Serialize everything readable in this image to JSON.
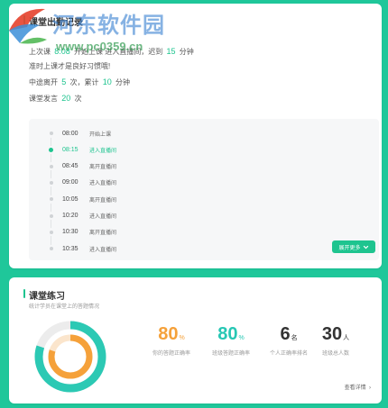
{
  "attendance": {
    "title": "课堂出勤记录",
    "line1": {
      "prefix": "上次课",
      "time": "8:08",
      "mid": "开始上课",
      "mid2": "进入直播间，迟到",
      "late": "15",
      "suffix": "分钟"
    },
    "line2": "准时上课才是良好习惯哦!",
    "line3": {
      "prefix": "中途离开",
      "leave_count": "5",
      "mid": "次，累计",
      "leave_minutes": "10",
      "suffix": "分钟"
    },
    "line4": {
      "prefix": "课堂发言",
      "speak_count": "20",
      "suffix": "次"
    },
    "timeline": [
      {
        "time": "08:00",
        "event": "开始上课",
        "active": false
      },
      {
        "time": "08:15",
        "event": "进入直播间",
        "active": true
      },
      {
        "time": "08:45",
        "event": "离开直播间",
        "active": false
      },
      {
        "time": "09:00",
        "event": "进入直播间",
        "active": false
      },
      {
        "time": "10:05",
        "event": "离开直播间",
        "active": false
      },
      {
        "time": "10:20",
        "event": "进入直播间",
        "active": false
      },
      {
        "time": "10:30",
        "event": "离开直播间",
        "active": false
      },
      {
        "time": "10:35",
        "event": "进入直播间",
        "active": false
      }
    ],
    "more_button": "展开更多"
  },
  "watermark": {
    "title": "河东软件园",
    "url": "www.pc0359.cn"
  },
  "practice": {
    "title": "课堂练习",
    "subtitle": "统计学员在课堂上的答题情况",
    "ring": {
      "outer_fraction": 0.8,
      "inner_fraction": 0.8
    },
    "metrics": [
      {
        "value": "80",
        "unit": "%",
        "label": "你的答题正确率",
        "color": "#f5a13a"
      },
      {
        "value": "80",
        "unit": "%",
        "label": "班级答题正确率",
        "color": "#27c7b4"
      },
      {
        "value": "6",
        "unit": "名",
        "label": "个人正确率排名",
        "color": "#333333"
      },
      {
        "value": "30",
        "unit": "人",
        "label": "班级总人数",
        "color": "#333333"
      }
    ],
    "view_detail": "查看详情"
  },
  "colors": {
    "accent": "#1ec48f",
    "page_bg": "#1fc79a"
  }
}
